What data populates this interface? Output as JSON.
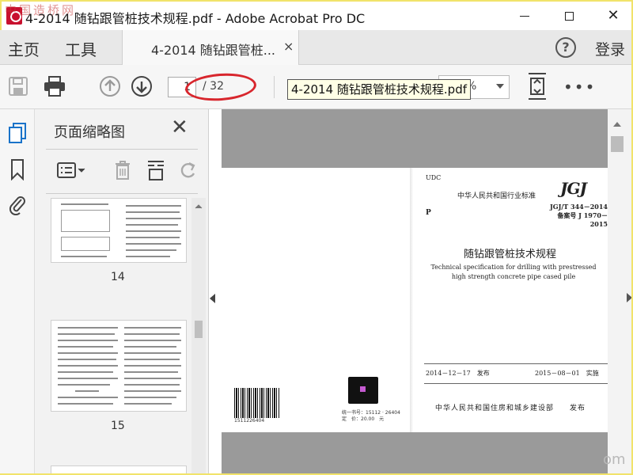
{
  "window": {
    "title": "4-2014 随钻跟管桩技术规程.pdf - Adobe Acrobat Pro DC",
    "watermark": "中国造桥网"
  },
  "menubar": {
    "home": "主页",
    "tools": "工具",
    "tab_title": "4-2014 随钻跟管桩...",
    "tab_close": "×",
    "help": "?",
    "login": "登录"
  },
  "toolbar": {
    "page_current": "1",
    "page_total": "/ 32",
    "zoom": "%",
    "more": "•••",
    "tooltip": "4-2014 随钻跟管桩技术规程.pdf"
  },
  "panel": {
    "title": "页面缩略图",
    "close": "✕",
    "thumbnails": [
      {
        "label": "14"
      },
      {
        "label": "15"
      }
    ]
  },
  "document": {
    "udc": "UDC",
    "category": "中华人民共和国行业标准",
    "p_mark": "P",
    "logo": "JGJ",
    "code_line1": "JGJ/T 344－2014",
    "code_line2": "备案号 J 1970－2015",
    "title_cn": "随钻跟管桩技术规程",
    "title_en_line1": "Technical specification for drilling with prestressed",
    "title_en_line2": "high strength concrete pipe cased pile",
    "issue_date": "2014－12－17　发布",
    "impl_date": "2015－08－01　实施",
    "publisher": "中华人民共和国住房和城乡建设部　　发布",
    "barcode_number": "1511226404",
    "book_number": "统一书号：15112 · 26404",
    "price": "定　价：20.00　元"
  },
  "footer_watermark": "om",
  "colors": {
    "accent_red": "#d8262d",
    "frame_yellow": "#f1e36a",
    "doc_background": "#9a9a9a"
  }
}
